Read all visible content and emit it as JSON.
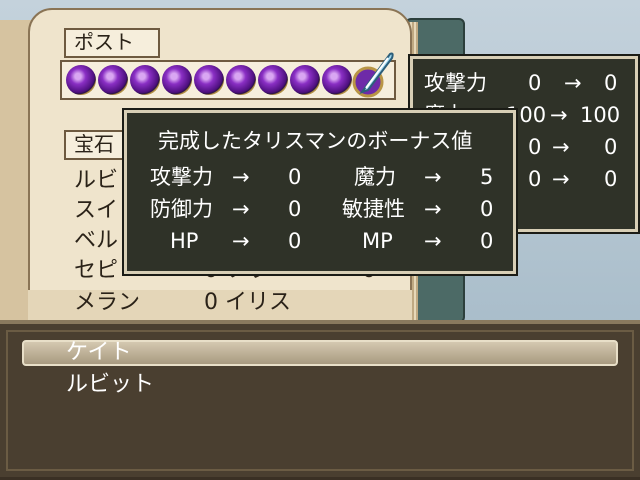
{
  "book": {
    "post_label": "ポスト",
    "treasure_label": "宝石",
    "orb_count": 9,
    "left_list": [
      "ルビ",
      "スイ",
      "ベル",
      "セピ",
      "メラン"
    ],
    "middle_fragments": {
      "row4": "0 ソウ",
      "row5": "0 イリス"
    },
    "right_fragment": "0"
  },
  "stat_window": {
    "rows": [
      {
        "label": "攻撃力",
        "before": "0",
        "arrow": "→",
        "after": "0"
      },
      {
        "label": "魔力",
        "before": "100",
        "arrow": "→",
        "after": "100"
      },
      {
        "label": "",
        "before": "0",
        "arrow": "→",
        "after": "0"
      },
      {
        "label": "",
        "before": "0",
        "arrow": "→",
        "after": "0"
      }
    ]
  },
  "bonus_window": {
    "title": "完成したタリスマンのボーナス値",
    "arrow": "→",
    "rows": [
      {
        "l_label": "攻撃力",
        "l_value": "0",
        "r_label": "魔力",
        "r_value": "5"
      },
      {
        "l_label": "防御力",
        "l_value": "0",
        "r_label": "敏捷性",
        "r_value": "0"
      },
      {
        "l_label": "HP",
        "l_value": "0",
        "r_label": "MP",
        "r_value": "0"
      }
    ]
  },
  "selection": {
    "items": [
      "ケイト",
      "ルビット"
    ],
    "selected_index": 0
  },
  "colors": {
    "window_bg": "#2f3228",
    "window_border": "#d8cfb6",
    "selection_bg": "#4a3f30",
    "orb": "#8a2fc4"
  }
}
